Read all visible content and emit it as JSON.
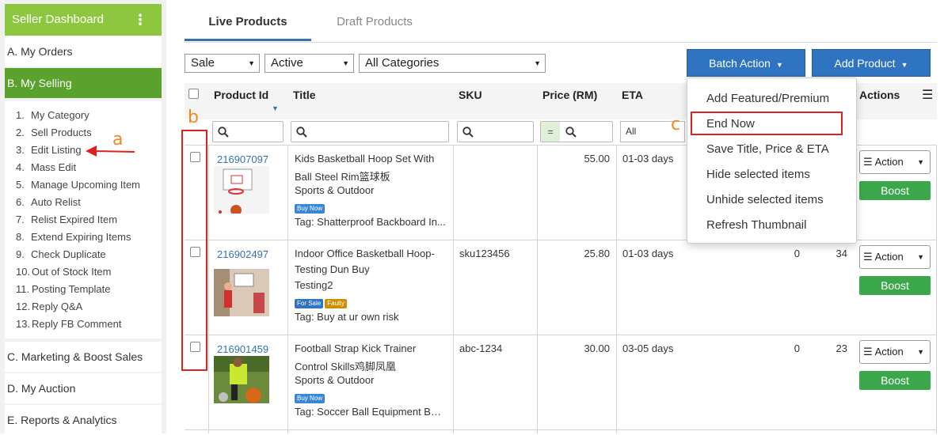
{
  "sidebar": {
    "header": "Seller Dashboard",
    "sections": {
      "a": "A. My Orders",
      "b": "B. My Selling",
      "c": "C. Marketing & Boost Sales",
      "d": "D. My Auction",
      "e": "E. Reports & Analytics"
    },
    "items": [
      {
        "num": "1.",
        "label": "My Category"
      },
      {
        "num": "2.",
        "label": "Sell Products"
      },
      {
        "num": "3.",
        "label": "Edit Listing"
      },
      {
        "num": "4.",
        "label": "Mass Edit"
      },
      {
        "num": "5.",
        "label": "Manage Upcoming Item"
      },
      {
        "num": "6.",
        "label": "Auto Relist"
      },
      {
        "num": "7.",
        "label": "Relist Expired Item"
      },
      {
        "num": "8.",
        "label": "Extend Expiring Items"
      },
      {
        "num": "9.",
        "label": "Check Duplicate"
      },
      {
        "num": "10.",
        "label": "Out of Stock Item"
      },
      {
        "num": "11.",
        "label": "Posting Template"
      },
      {
        "num": "12.",
        "label": "Reply Q&A"
      },
      {
        "num": "13.",
        "label": "Reply FB Comment"
      }
    ]
  },
  "annotations": {
    "a": "a",
    "b": "b",
    "c": "c"
  },
  "tabs": {
    "live": "Live Products",
    "draft": "Draft Products"
  },
  "filters": {
    "type": "Sale",
    "status": "Active",
    "category": "All Categories",
    "eta": "All"
  },
  "buttons": {
    "batch": "Batch Action",
    "add": "Add Product"
  },
  "columns": {
    "product_id": "Product Id",
    "title": "Title",
    "sku": "SKU",
    "price": "Price (RM)",
    "eta": "ETA",
    "actions": "Actions"
  },
  "price_filter_eq": "=",
  "batch_menu": [
    "Add Featured/Premium",
    "End Now",
    "Save Title, Price & ETA",
    "Hide selected items",
    "Unhide selected items",
    "Refresh Thumbnail"
  ],
  "rows": [
    {
      "id": "216907097",
      "title1": "Kids Basketball Hoop Set With",
      "title2": "Ball Steel Rim篮球板",
      "category": "Sports & Outdoor",
      "badges": [
        "Buy Now"
      ],
      "tag": "Tag: Shatterproof Backboard In...",
      "sku": "",
      "price": "55.00",
      "eta": "01-03 days",
      "col6": "",
      "col7": "",
      "action": "Action",
      "boost": "Boost"
    },
    {
      "id": "216902497",
      "title1": "Indoor Office Basketball Hoop-",
      "title2": "Testing Dun Buy",
      "category": "Testing2",
      "badges": [
        "For Sale",
        "Faulty"
      ],
      "tag": "Tag: Buy at ur own risk",
      "sku": "sku123456",
      "price": "25.80",
      "eta": "01-03 days",
      "col6": "0",
      "col7": "34",
      "action": "Action",
      "boost": "Boost"
    },
    {
      "id": "216901459",
      "title1": "Football Strap Kick Trainer",
      "title2": "Control Skills鸡脚凤凰",
      "category": "Sports & Outdoor",
      "badges": [
        "Buy Now"
      ],
      "tag": "Tag: Soccer Ball Equipment Belt...",
      "sku": "abc-1234",
      "price": "30.00",
      "eta": "03-05 days",
      "col6": "0",
      "col7": "23",
      "action": "Action",
      "boost": "Boost"
    }
  ],
  "colors": {
    "sidebar_header": "#8dc63f",
    "sidebar_active": "#5aa22d",
    "primary": "#2f74c0",
    "boost": "#3aa84a",
    "highlight": "#e02020",
    "annotation": "#ef8a1e"
  }
}
